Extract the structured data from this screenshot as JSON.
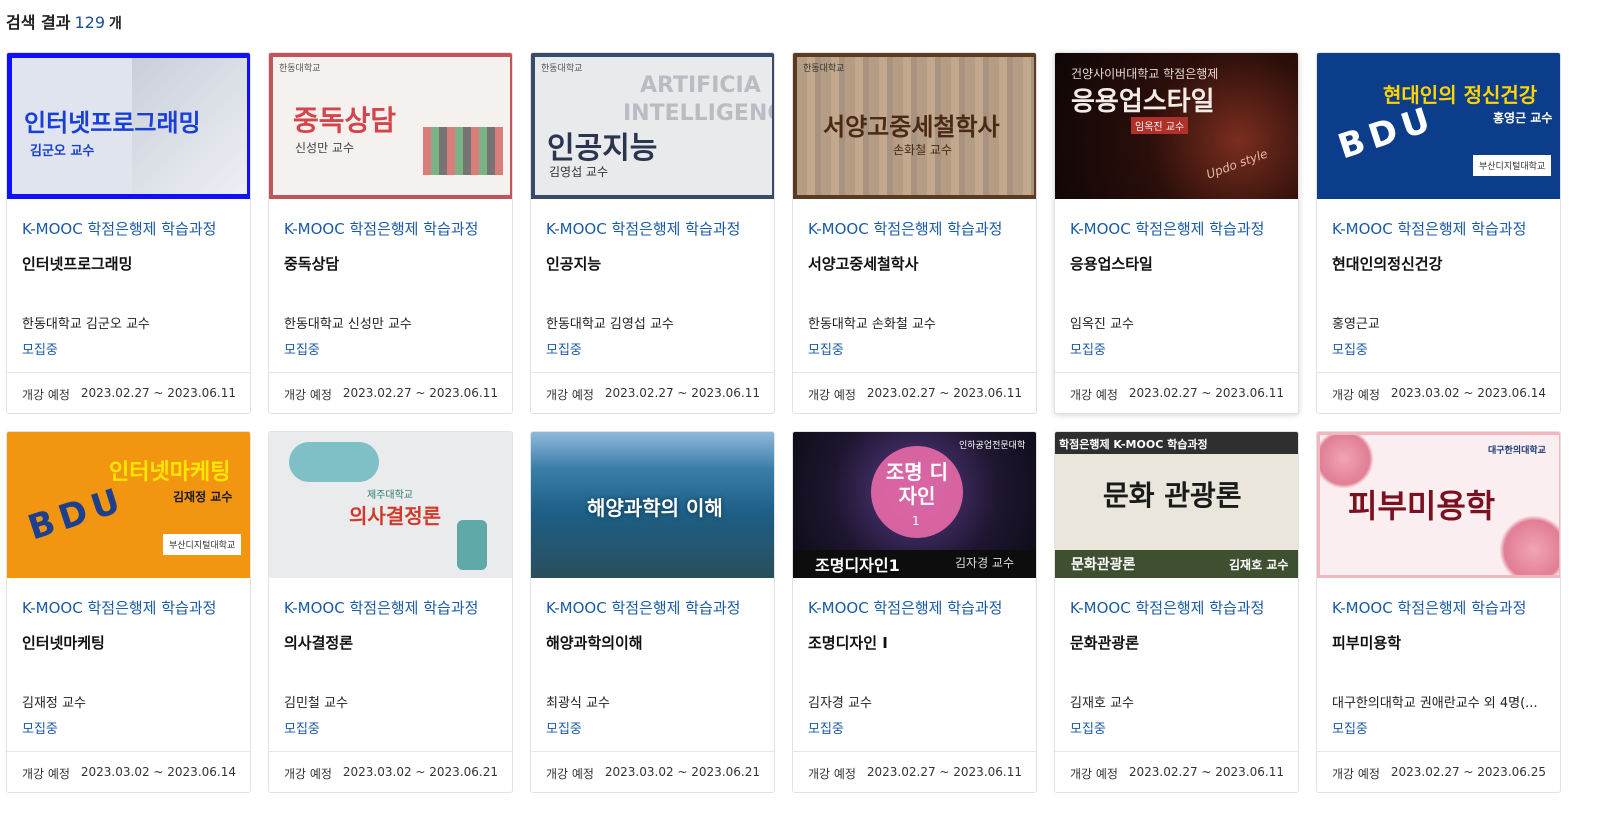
{
  "header": {
    "label": "검색 결과",
    "count": "129",
    "unit": "개"
  },
  "colors": {
    "category": "#1a5aa8",
    "status": "#1a5aa8",
    "count": "#1a4f9c"
  },
  "courses": [
    {
      "category": "K-MOOC 학점은행제 학습과정",
      "title": "인터넷프로그래밍",
      "instructor": "한동대학교 김군오 교수",
      "status": "모집중",
      "open_label": "개강 예정",
      "dates": "2023.02.27 ~ 2023.06.11",
      "thumb": {
        "title": "인터넷프로그래밍",
        "sub": "김군오 교수"
      }
    },
    {
      "category": "K-MOOC 학점은행제 학습과정",
      "title": "중독상담",
      "instructor": "한동대학교 신성만 교수",
      "status": "모집중",
      "open_label": "개강 예정",
      "dates": "2023.02.27 ~ 2023.06.11",
      "thumb": {
        "title": "중독상담",
        "sub": "신성만 교수",
        "logo": "한동대학교"
      }
    },
    {
      "category": "K-MOOC 학점은행제 학습과정",
      "title": "인공지능",
      "instructor": "한동대학교 김영섭 교수",
      "status": "모집중",
      "open_label": "개강 예정",
      "dates": "2023.02.27 ~ 2023.06.11",
      "thumb": {
        "title": "인공지능",
        "sub": "김영섭 교수",
        "logo": "한동대학교",
        "bg1": "ARTIFICIA",
        "bg2": "INTELLIGENC"
      }
    },
    {
      "category": "K-MOOC 학점은행제 학습과정",
      "title": "서양고중세철학사",
      "instructor": "한동대학교 손화철 교수",
      "status": "모집중",
      "open_label": "개강 예정",
      "dates": "2023.02.27 ~ 2023.06.11",
      "thumb": {
        "title": "서양고중세철학사",
        "sub": "손화철 교수",
        "logo": "한동대학교"
      }
    },
    {
      "category": "K-MOOC 학점은행제 학습과정",
      "title": "응용업스타일",
      "instructor": "임옥진 교수",
      "status": "모집중",
      "open_label": "개강 예정",
      "dates": "2023.02.27 ~ 2023.06.11",
      "thumb": {
        "title": "응용업스타일",
        "sub": "임옥진 교수",
        "top": "건양사이버대학교 학점은행제",
        "script": "Updo style"
      }
    },
    {
      "category": "K-MOOC 학점은행제 학습과정",
      "title": "현대인의정신건강",
      "instructor": "홍영근교",
      "status": "모집중",
      "open_label": "개강 예정",
      "dates": "2023.03.02 ~ 2023.06.14",
      "thumb": {
        "title": "현대인의 정신건강",
        "sub": "홍영근 교수",
        "logo": "부산디지털대학교"
      }
    },
    {
      "category": "K-MOOC 학점은행제 학습과정",
      "title": "인터넷마케팅",
      "instructor": "김재정 교수",
      "status": "모집중",
      "open_label": "개강 예정",
      "dates": "2023.03.02 ~ 2023.06.14",
      "thumb": {
        "title": "인터넷마케팅",
        "sub": "김재정 교수",
        "logo": "부산디지털대학교"
      }
    },
    {
      "category": "K-MOOC 학점은행제 학습과정",
      "title": "의사결정론",
      "instructor": "김민철 교수",
      "status": "모집중",
      "open_label": "개강 예정",
      "dates": "2023.03.02 ~ 2023.06.21",
      "thumb": {
        "title": "의사결정론",
        "logo": "제주대학교"
      }
    },
    {
      "category": "K-MOOC 학점은행제 학습과정",
      "title": "해양과학의이해",
      "instructor": "최광식 교수",
      "status": "모집중",
      "open_label": "개강 예정",
      "dates": "2023.03.02 ~ 2023.06.21",
      "thumb": {
        "title": "해양과학의 이해"
      }
    },
    {
      "category": "K-MOOC 학점은행제 학습과정",
      "title": "조명디자인 I",
      "instructor": "김자경 교수",
      "status": "모집중",
      "open_label": "개강 예정",
      "dates": "2023.02.27 ~ 2023.06.11",
      "thumb": {
        "title": "조명 디자인",
        "num": "1",
        "bar": "조명디자인1",
        "sub": "김자경 교수",
        "logo": "인하공업전문대학"
      }
    },
    {
      "category": "K-MOOC 학점은행제 학습과정",
      "title": "문화관광론",
      "instructor": "김재호 교수",
      "status": "모집중",
      "open_label": "개강 예정",
      "dates": "2023.02.27 ~ 2023.06.11",
      "thumb": {
        "title": "문화 관광론",
        "top": "학점은행제 K-MOOC 학습과정",
        "bar": "문화관광론",
        "sub": "김재호 교수"
      }
    },
    {
      "category": "K-MOOC 학점은행제 학습과정",
      "title": "피부미용학",
      "instructor": "대구한의대학교 권애란교수 외 4명(...",
      "status": "모집중",
      "open_label": "개강 예정",
      "dates": "2023.02.27 ~ 2023.06.25",
      "thumb": {
        "title": "피부미용학",
        "logo": "대구한의대학교"
      }
    }
  ]
}
